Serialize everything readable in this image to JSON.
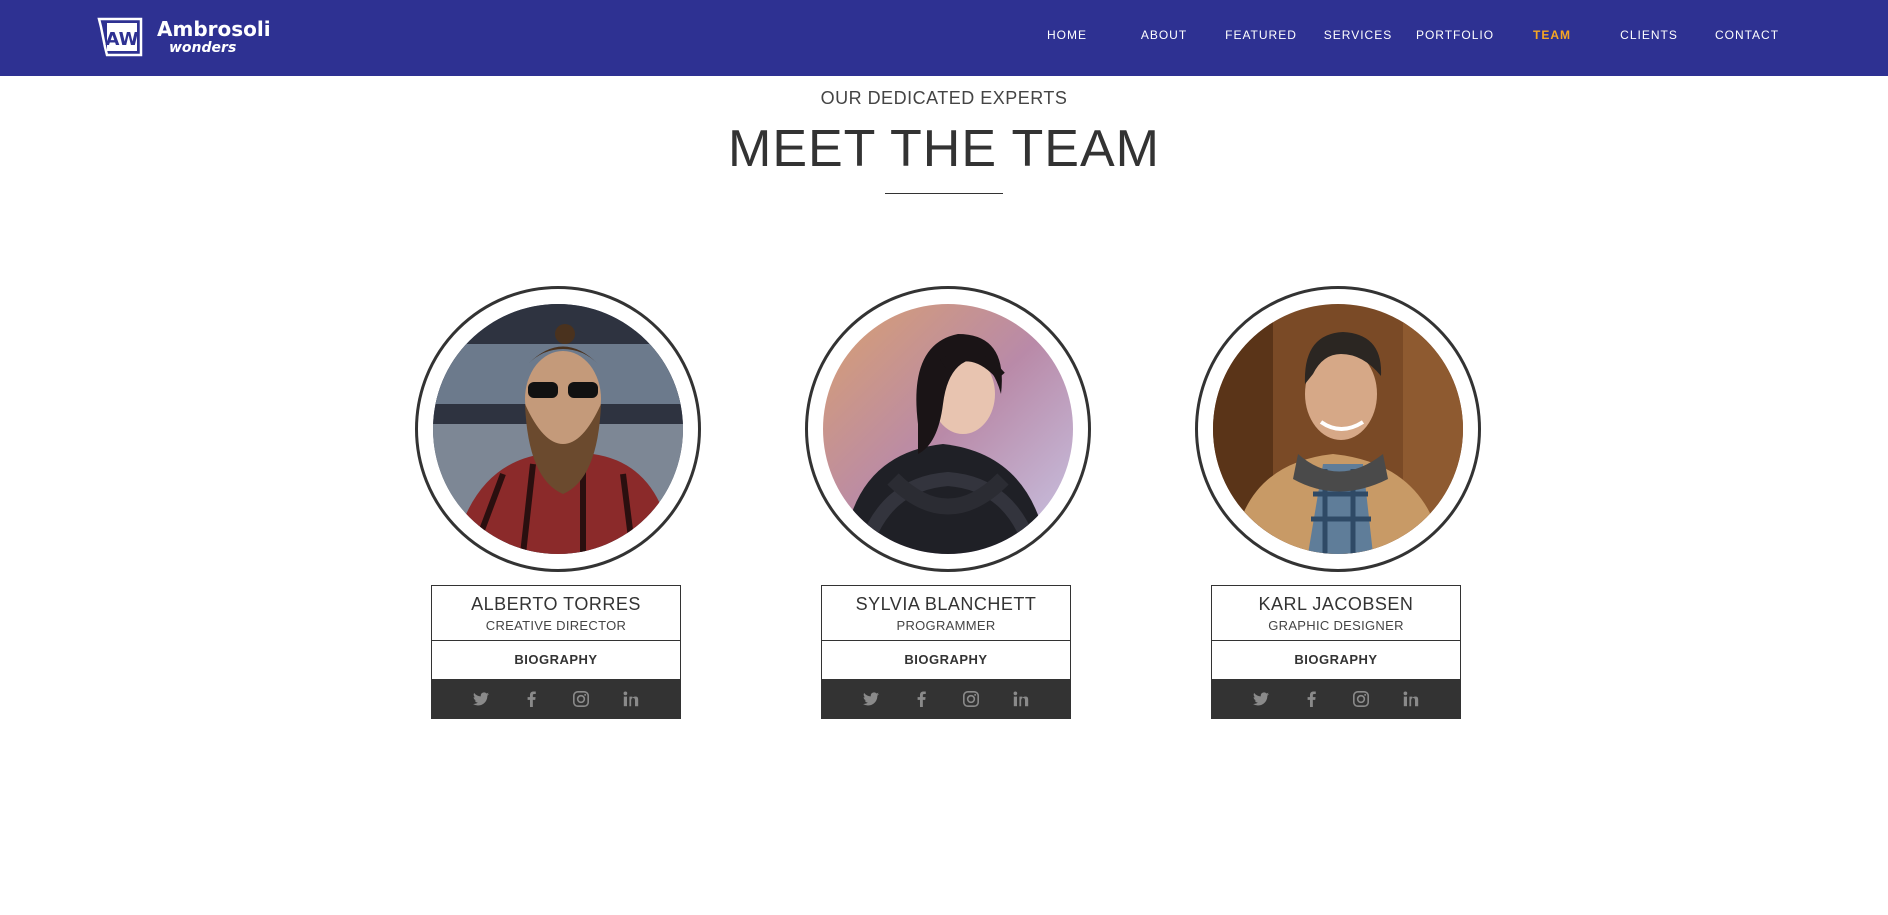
{
  "brand": {
    "name_line1": "Ambrosoli",
    "name_line2": "wonders",
    "mark_text": "AW",
    "logo_color": "#ffffff"
  },
  "nav": {
    "background": "#2e3192",
    "active_color": "#f6a623",
    "items": [
      {
        "label": "HOME",
        "active": false
      },
      {
        "label": "ABOUT",
        "active": false
      },
      {
        "label": "FEATURED",
        "active": false
      },
      {
        "label": "SERVICES",
        "active": false
      },
      {
        "label": "PORTFOLIO",
        "active": false
      },
      {
        "label": "TEAM",
        "active": true
      },
      {
        "label": "CLIENTS",
        "active": false
      },
      {
        "label": "CONTACT",
        "active": false
      }
    ]
  },
  "section": {
    "eyebrow": "OUR DEDICATED EXPERTS",
    "title": "MEET THE TEAM"
  },
  "team": [
    {
      "name": "ALBERTO TORRES",
      "role": "CREATIVE DIRECTOR",
      "bio_label": "BIOGRAPHY",
      "photo": "bearded-man-sunglasses-plaid-shirt",
      "social": [
        "twitter-icon",
        "facebook-icon",
        "instagram-icon",
        "linkedin-icon"
      ]
    },
    {
      "name": "SYLVIA BLANCHETT",
      "role": "PROGRAMMER",
      "bio_label": "BIOGRAPHY",
      "photo": "dark-haired-woman-knit-scarf",
      "social": [
        "twitter-icon",
        "facebook-icon",
        "instagram-icon",
        "linkedin-icon"
      ]
    },
    {
      "name": "KARL JACOBSEN",
      "role": "GRAPHIC DESIGNER",
      "bio_label": "BIOGRAPHY",
      "photo": "smiling-man-brown-jacket",
      "social": [
        "twitter-icon",
        "facebook-icon",
        "instagram-icon",
        "linkedin-icon"
      ]
    }
  ]
}
